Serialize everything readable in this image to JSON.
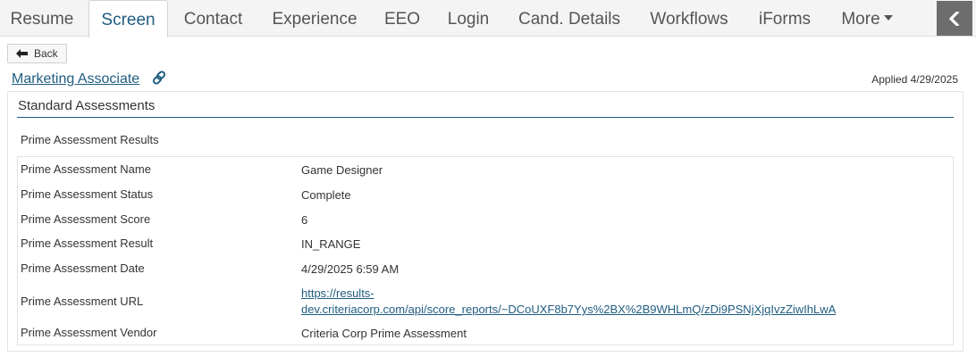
{
  "tabs": [
    {
      "label": "Resume"
    },
    {
      "label": "Screen"
    },
    {
      "label": "Contact"
    },
    {
      "label": "Experience"
    },
    {
      "label": "EEO"
    },
    {
      "label": "Login"
    },
    {
      "label": "Cand. Details"
    },
    {
      "label": "Workflows"
    },
    {
      "label": "iForms"
    },
    {
      "label": "More"
    }
  ],
  "active_tab": "Screen",
  "back_label": "Back",
  "job": {
    "title": "Marketing Associate",
    "applied": "Applied 4/29/2025"
  },
  "panel": {
    "title": "Standard Assessments",
    "section_title": "Prime Assessment Results",
    "rows": [
      {
        "label": "Prime Assessment Name",
        "value": "Game Designer"
      },
      {
        "label": "Prime Assessment Status",
        "value": "Complete"
      },
      {
        "label": "Prime Assessment Score",
        "value": "6"
      },
      {
        "label": "Prime Assessment Result",
        "value": "IN_RANGE"
      },
      {
        "label": "Prime Assessment Date",
        "value": "4/29/2025 6:59 AM"
      },
      {
        "label": "Prime Assessment URL",
        "value_line1": "https://results-",
        "value_line2": "dev.criteriacorp.com/api/score_reports/~DCoUXF8b7Yys%2BX%2B9WHLmQ/zDi9PSNjXjqIvzZiwIhLwA"
      },
      {
        "label": "Prime Assessment Vendor",
        "value": "Criteria Corp Prime Assessment"
      }
    ]
  },
  "colors": {
    "accent": "#1f5c80",
    "tab_bar_bg": "#f4f4f4",
    "collapse_bg": "#6d6d6d"
  },
  "icons": {
    "back": "arrow-left-icon",
    "job_link": "link-icon",
    "collapse": "chevron-left-icon",
    "more": "caret-down-icon"
  }
}
